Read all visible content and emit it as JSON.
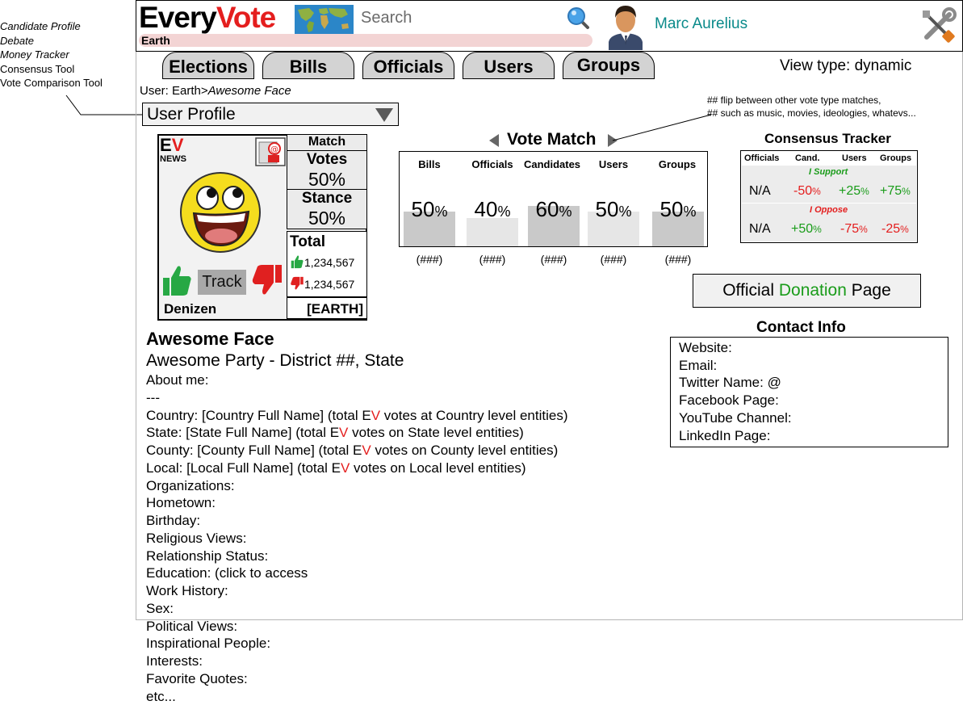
{
  "side_notes": [
    {
      "text": "Candidate Profile",
      "italic": true
    },
    {
      "text": "Debate",
      "italic": true
    },
    {
      "text": "Money Tracker",
      "italic": true
    },
    {
      "text": "Consensus Tool",
      "italic": false
    },
    {
      "text": "Vote Comparison Tool",
      "italic": false
    }
  ],
  "header": {
    "logo_part1": "Every",
    "logo_part2": "Vote",
    "search_placeholder": "Search",
    "location": "Earth",
    "username": "Marc Aurelius"
  },
  "tabs": [
    "Elections",
    "Bills",
    "Officials",
    "Users",
    "Groups"
  ],
  "view_type": "View type: dynamic",
  "breadcrumb": {
    "prefix": "User: Earth>",
    "current": "Awesome Face"
  },
  "profile_select": "User Profile",
  "card": {
    "logo_e": "E",
    "logo_v": "V",
    "news": "NEWS",
    "match_label": "Match",
    "votes_label": "Votes",
    "votes_value": "50%",
    "stance_label": "Stance",
    "stance_value": "50%",
    "total_label": "Total",
    "up_count": "1,234,567",
    "down_count": "1,234,567",
    "track_label": "Track",
    "role": "Denizen",
    "region": "[EARTH]"
  },
  "vote_match": {
    "title": "Vote Match",
    "columns": [
      {
        "label": "Bills",
        "value": "50",
        "count": "(###)"
      },
      {
        "label": "Officials",
        "value": "40",
        "count": "(###)"
      },
      {
        "label": "Candidates",
        "value": "60",
        "count": "(###)"
      },
      {
        "label": "Users",
        "value": "50",
        "count": "(###)"
      },
      {
        "label": "Groups",
        "value": "50",
        "count": "(###)"
      }
    ],
    "percent_sign": "%"
  },
  "note": {
    "line1": "## flip between other vote type matches,",
    "line2": "## such as music, movies, ideologies, whatevs..."
  },
  "consensus": {
    "title": "Consensus Tracker",
    "headers": [
      "Officials",
      "Cand.",
      "Users",
      "Groups"
    ],
    "support_label": "I Support",
    "oppose_label": "I Oppose",
    "support_row": {
      "officials": "N/A",
      "cand": "-50",
      "users": "+25",
      "groups": "+75"
    },
    "oppose_row": {
      "officials": "N/A",
      "cand": "+50",
      "users": "-75",
      "groups": "-25"
    },
    "percent_sign": "%"
  },
  "donation": {
    "part1": "Official ",
    "part2": "Donation",
    "part3": " Page"
  },
  "contact": {
    "title": "Contact Info",
    "lines": [
      "Website:",
      "Email:",
      "Twitter Name: @",
      "Facebook Page:",
      "YouTube Channel:",
      "LinkedIn Page:"
    ]
  },
  "profile": {
    "name": "Awesome Face",
    "party": "Awesome Party - District ##, State",
    "lines": [
      "About me:",
      "---",
      "Country: [Country Full Name] (total EV votes at Country level entities)",
      "State: [State Full Name] (total EV votes on State level entities)",
      "County: [County Full Name] (total EV votes on County level entities)",
      "Local: [Local Full Name] (total EV votes on Local level entities)",
      "Organizations:",
      "Hometown:",
      "Birthday:",
      "Religious Views:",
      "Relationship Status:",
      "Education: (click to access",
      "Work History:",
      "Sex:",
      "Political Views:",
      "Inspirational People:",
      "Interests:",
      "Favorite Quotes:",
      "etc..."
    ]
  },
  "colors": {
    "brand_red": "#e41e1e",
    "teal": "#0a8a8a",
    "support_green": "#1a9c1a"
  }
}
